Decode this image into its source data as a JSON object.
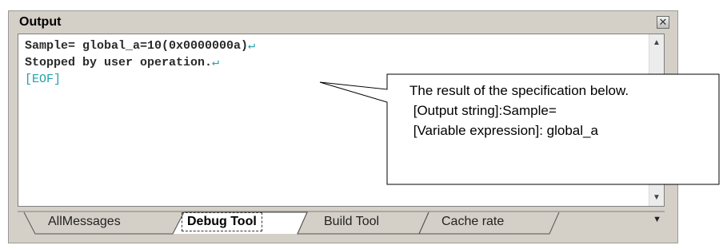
{
  "panel": {
    "title": "Output",
    "close_symbol": "✕"
  },
  "output": {
    "lines": [
      {
        "text": "Sample= global_a=10(0x0000000a)",
        "newline_marker": "↵"
      },
      {
        "text": "Stopped by user operation.",
        "newline_marker": "↵"
      },
      {
        "text": "[EOF]",
        "newline_marker": ""
      }
    ]
  },
  "scroll": {
    "up": "▲",
    "down": "▼"
  },
  "tabs": [
    {
      "label": "AllMessages",
      "selected": false
    },
    {
      "label": "Debug Tool",
      "selected": true
    },
    {
      "label": "Build Tool",
      "selected": false
    },
    {
      "label": "Cache rate",
      "selected": false
    }
  ],
  "tab_menu": "▼",
  "callout": {
    "lines": [
      "The result of the specification below.",
      " [Output string]:Sample=",
      " [Variable expression]: global_a"
    ]
  }
}
